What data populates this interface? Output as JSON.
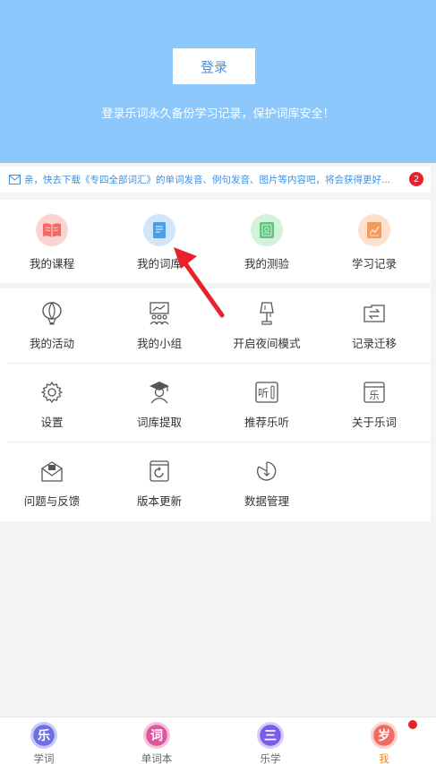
{
  "header": {
    "login_label": "登录",
    "tip": "登录乐词永久备份学习记录，保护词库安全！",
    "bg_color": "#8cc8fb"
  },
  "notice": {
    "icon": "mail-icon",
    "text": "亲，快去下载《专四全部词汇》的单词发音、例句发音、图片等内容吧，将会获得更好...",
    "badge": "2"
  },
  "quick_menu": [
    {
      "label": "我的课程",
      "icon": "book-open-icon",
      "color": "#f26b63",
      "bg": "#fcd3d1"
    },
    {
      "label": "我的词库",
      "icon": "wordbook-icon",
      "color": "#4a9fe8",
      "bg": "#cfe6fb"
    },
    {
      "label": "我的测验",
      "icon": "quiz-icon",
      "color": "#5cc77a",
      "bg": "#d3f2dc"
    },
    {
      "label": "学习记录",
      "icon": "chart-record-icon",
      "color": "#f49a5a",
      "bg": "#fde0cd"
    }
  ],
  "grid_menu": [
    {
      "label": "我的活动",
      "icon": "balloon-icon"
    },
    {
      "label": "我的小组",
      "icon": "group-icon"
    },
    {
      "label": "开启夜间模式",
      "icon": "lamp-icon"
    },
    {
      "label": "记录迁移",
      "icon": "transfer-icon"
    },
    {
      "label": "设置",
      "icon": "gear-icon"
    },
    {
      "label": "词库提取",
      "icon": "graduate-icon"
    },
    {
      "label": "推荐乐听",
      "icon": "listen-icon",
      "glyph": "听"
    },
    {
      "label": "关于乐词",
      "icon": "about-icon",
      "glyph": "乐"
    },
    {
      "label": "问题与反馈",
      "icon": "feedback-mail-icon"
    },
    {
      "label": "版本更新",
      "icon": "update-icon"
    },
    {
      "label": "数据管理",
      "icon": "data-manage-icon"
    }
  ],
  "tabs": [
    {
      "label": "学词",
      "glyph": "乐",
      "color": "#6e6fe6"
    },
    {
      "label": "单词本",
      "glyph": "词",
      "color": "#e0559d"
    },
    {
      "label": "乐学",
      "glyph": "三",
      "color": "#7a5ce8"
    },
    {
      "label": "我",
      "glyph": "岁",
      "color": "#f26b63",
      "active": true
    }
  ],
  "colors": {
    "accent_blue": "#3a8fe0",
    "badge_red": "#e8212a",
    "active_tab": "#f0861a",
    "arrow_red": "#e8212a"
  }
}
